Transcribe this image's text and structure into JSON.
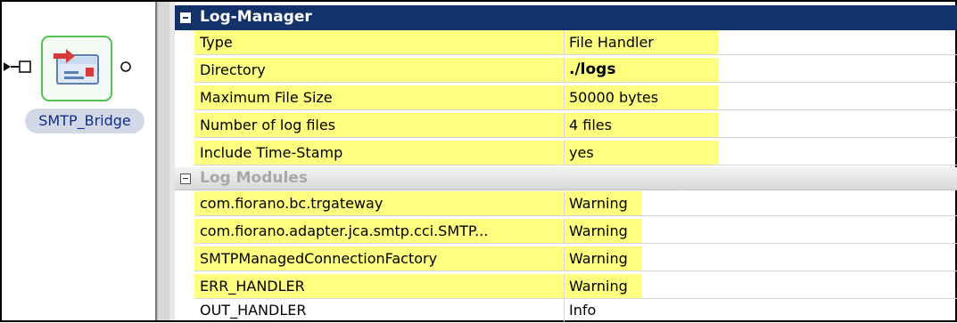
{
  "canvas": {
    "component": {
      "label": "SMTP_Bridge",
      "icon": "smtp-bridge-icon"
    },
    "input_port_icon": "input-port-icon",
    "output_port_icon": "output-port-icon",
    "colors": {
      "node_border": "#4fc24f",
      "label_bg": "#d3d8e6",
      "label_text": "#102d8a"
    }
  },
  "property_sheet": {
    "sections": [
      {
        "title": "Log-Manager",
        "expanded": true,
        "rows": [
          {
            "name": "Type",
            "value": "File Handler",
            "highlighted": true
          },
          {
            "name": "Directory",
            "value": "./logs",
            "highlighted": true,
            "bold_value": true
          },
          {
            "name": "Maximum File Size",
            "value": "50000 bytes",
            "highlighted": true
          },
          {
            "name": "Number of log files",
            "value": "4 files",
            "highlighted": true
          },
          {
            "name": "Include Time-Stamp",
            "value": "yes",
            "highlighted": true
          }
        ]
      },
      {
        "title": "Log Modules",
        "expanded": true,
        "rows": [
          {
            "name": "com.fiorano.bc.trgateway",
            "value": "Warning",
            "highlighted": true
          },
          {
            "name": "com.fiorano.adapter.jca.smtp.cci.SMTP...",
            "value": "Warning",
            "highlighted": true
          },
          {
            "name": "SMTPManagedConnectionFactory",
            "value": "Warning",
            "highlighted": true
          },
          {
            "name": "ERR_HANDLER",
            "value": "Warning",
            "highlighted": true
          },
          {
            "name": "OUT_HANDLER",
            "value": "Info",
            "highlighted": false
          }
        ]
      }
    ],
    "colors": {
      "header_bg": "#123269",
      "highlight": "#ffff80",
      "subheader_text": "#a8a8a8"
    }
  }
}
